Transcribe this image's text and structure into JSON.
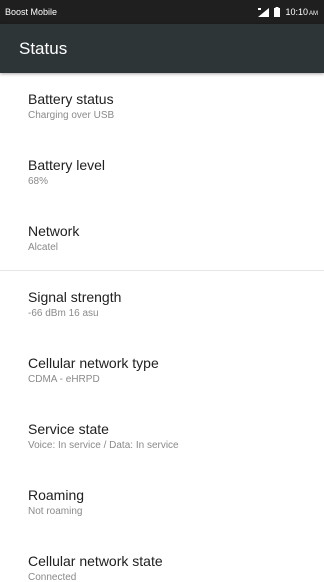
{
  "status_bar": {
    "carrier": "Boost Mobile",
    "time": "10:10",
    "ampm": "AM"
  },
  "app_bar": {
    "title": "Status"
  },
  "items": [
    {
      "title": "Battery status",
      "summary": "Charging over USB"
    },
    {
      "title": "Battery level",
      "summary": "68%"
    },
    {
      "title": "Network",
      "summary": "Alcatel"
    },
    {
      "title": "Signal strength",
      "summary": "-66 dBm   16 asu"
    },
    {
      "title": "Cellular network type",
      "summary": "CDMA - eHRPD"
    },
    {
      "title": "Service state",
      "summary": "Voice: In service / Data: In service"
    },
    {
      "title": "Roaming",
      "summary": "Not roaming"
    },
    {
      "title": "Cellular network state",
      "summary": "Connected"
    }
  ],
  "colors": {
    "status_bar_bg": "#1f1f1f",
    "app_bar_bg": "#2e3537"
  },
  "icons": [
    "signal-icon",
    "battery-icon"
  ]
}
